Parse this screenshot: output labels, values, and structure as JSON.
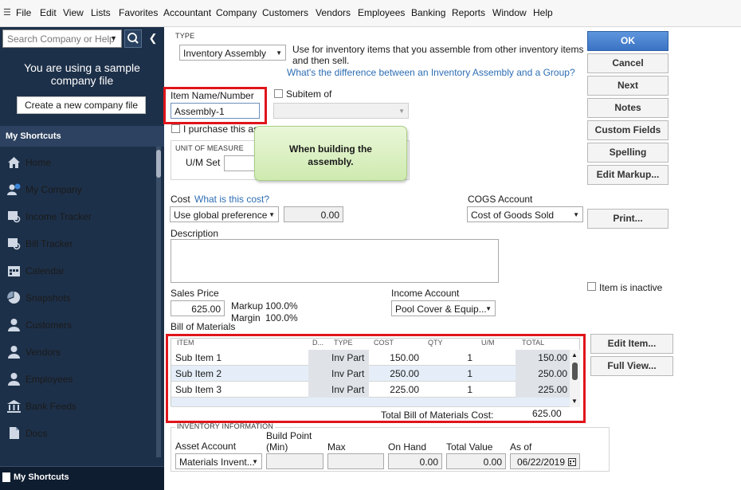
{
  "menu": {
    "items": [
      "File",
      "Edit",
      "View",
      "Lists",
      "Favorites",
      "Accountant",
      "Company",
      "Customers",
      "Vendors",
      "Employees",
      "Banking",
      "Reports",
      "Window",
      "Help"
    ]
  },
  "sidebar": {
    "search_placeholder": "Search Company or Help",
    "sample_line1": "You are using a sample",
    "sample_line2": "company file",
    "create_button": "Create a new company file",
    "shortcuts_header": "My Shortcuts",
    "items": [
      "Home",
      "My Company",
      "Income Tracker",
      "Bill Tracker",
      "Calendar",
      "Snapshots",
      "Customers",
      "Vendors",
      "Employees",
      "Bank Feeds",
      "Docs"
    ],
    "bottom_label": "My Shortcuts"
  },
  "form": {
    "type_label": "TYPE",
    "type_value": "Inventory Assembly",
    "type_description_1": "Use for inventory items that you assemble from other inventory items",
    "type_description_2": "and then sell.",
    "type_link": "What's the difference between an Inventory Assembly and a Group?",
    "item_name_label": "Item Name/Number",
    "item_name_value": "Assembly-1",
    "subitem_label": "Subitem of",
    "purchase_label": "I purchase this ass",
    "um_header": "UNIT OF MEASURE",
    "um_set_label": "U/M Set",
    "cost_label": "Cost",
    "cost_link": "What is this cost?",
    "cost_pref": "Use global preference",
    "cost_value": "0.00",
    "cogs_label": "COGS Account",
    "cogs_value": "Cost of Goods Sold",
    "description_label": "Description",
    "sales_price_label": "Sales Price",
    "sales_price_value": "625.00",
    "markup_label": "Markup",
    "markup_value": "100.0%",
    "margin_label": "Margin",
    "margin_value": "100.0%",
    "income_account_label": "Income Account",
    "income_account_value": "Pool Cover & Equip...",
    "bom_label": "Bill of Materials",
    "inactive_label": "Item is inactive"
  },
  "callout": {
    "line1": "When building the",
    "line2": "assembly."
  },
  "buttons": {
    "ok": "OK",
    "cancel": "Cancel",
    "next": "Next",
    "notes": "Notes",
    "custom_fields": "Custom Fields",
    "spelling": "Spelling",
    "edit_markup": "Edit Markup...",
    "print": "Print...",
    "edit_item": "Edit Item...",
    "full_view": "Full View..."
  },
  "bom": {
    "headers": [
      "ITEM",
      "D...",
      "TYPE",
      "COST",
      "QTY",
      "U/M",
      "TOTAL"
    ],
    "rows": [
      {
        "item": "Sub Item 1",
        "type": "Inv Part",
        "cost": "150.00",
        "qty": "1",
        "total": "150.00"
      },
      {
        "item": "Sub Item 2",
        "type": "Inv Part",
        "cost": "250.00",
        "qty": "1",
        "total": "250.00"
      },
      {
        "item": "Sub Item 3",
        "type": "Inv Part",
        "cost": "225.00",
        "qty": "1",
        "total": "225.00"
      }
    ],
    "total_label": "Total Bill of Materials Cost:",
    "total_value": "625.00"
  },
  "inventory": {
    "header": "INVENTORY INFORMATION",
    "asset_account_label": "Asset Account",
    "asset_account_value": "Materials Invent...",
    "build_point_label_1": "Build Point",
    "build_point_label_2": "(Min)",
    "max_label": "Max",
    "on_hand_label": "On Hand",
    "on_hand_value": "0.00",
    "total_value_label": "Total Value",
    "total_value_value": "0.00",
    "as_of_label": "As of",
    "as_of_value": "06/22/2019"
  },
  "colors": {
    "highlight": "#e0141b",
    "sidebar": "#1d3049",
    "primary_button": "#3b73c4",
    "link": "#2d6db3"
  }
}
